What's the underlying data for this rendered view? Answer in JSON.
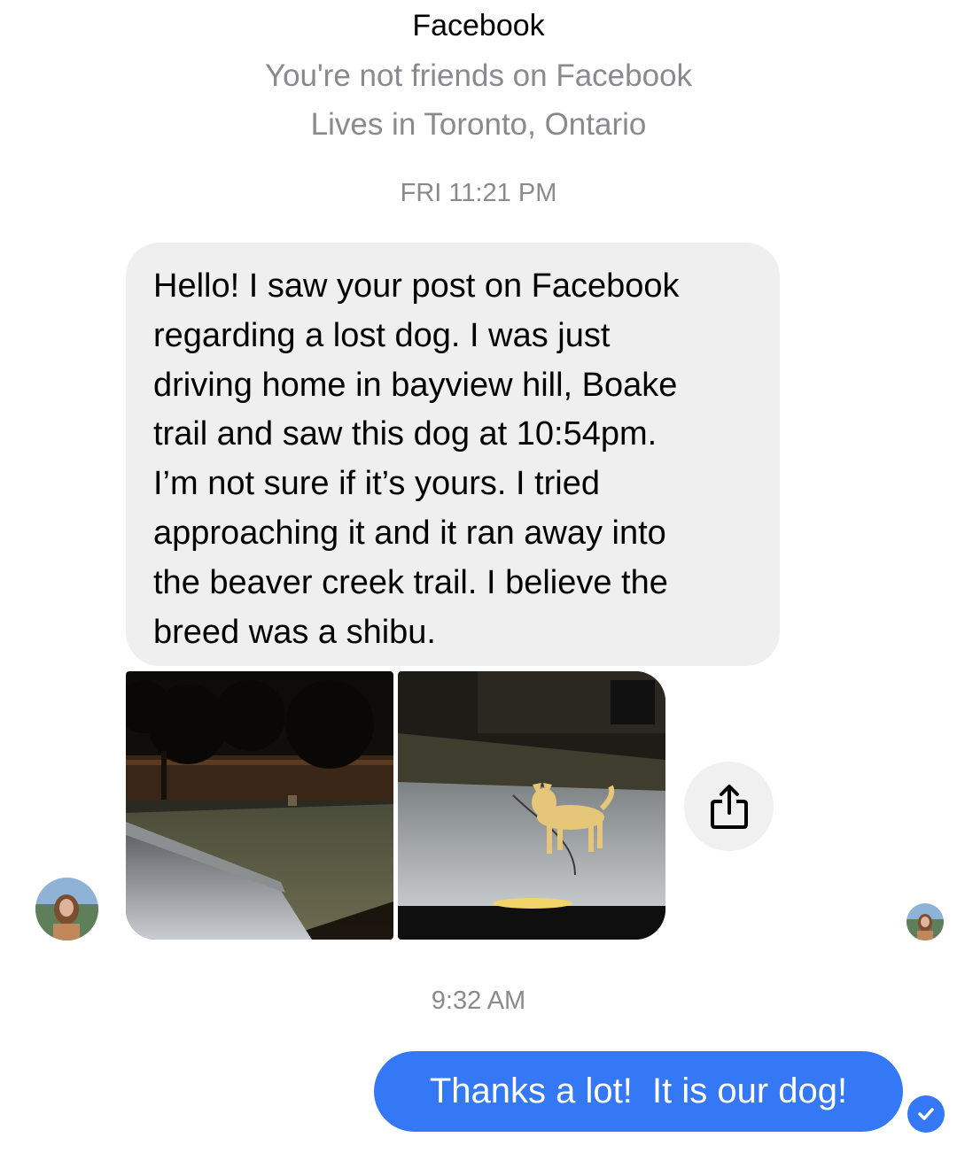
{
  "header": {
    "name": "Facebook",
    "friend_status": "You're not friends on Facebook",
    "location": "Lives in Toronto, Ontario"
  },
  "messages": [
    {
      "timestamp": "FRI 11:21 PM",
      "direction": "incoming",
      "text": "Hello! I saw your post on Facebook\nregarding a lost dog. I was just\ndriving home in bayview hill, Boake\ntrail and saw this dog at 10:54pm.\nI’m not sure if it’s yours. I tried\napproaching it and it ran away into\nthe beaver creek trail. I believe the\nbreed was a shibu.",
      "attachments": [
        {
          "icon": "night-street-photo"
        },
        {
          "icon": "dog-on-road-photo"
        }
      ]
    },
    {
      "timestamp": "9:32 AM",
      "direction": "outgoing",
      "text": "Thanks a lot!  It is our dog!"
    }
  ],
  "actions": {
    "share_icon": "share-icon"
  },
  "colors": {
    "outgoing_bubble": "#3478f6",
    "incoming_bubble": "#efefef",
    "meta_text": "#8a8a8e"
  }
}
